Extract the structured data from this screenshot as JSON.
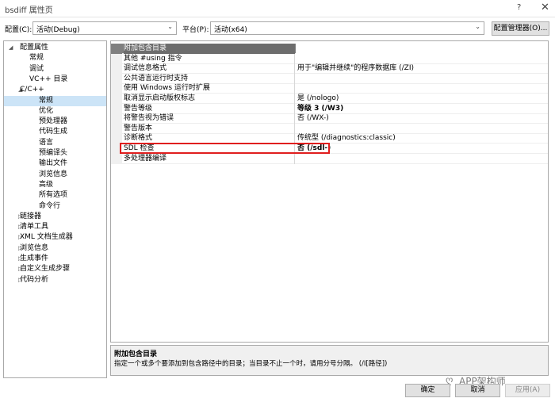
{
  "window": {
    "title": "bsdiff 属性页",
    "help": "?",
    "close": "✕"
  },
  "config": {
    "config_label": "配置(C):",
    "config_value": "活动(Debug)",
    "platform_label": "平台(P):",
    "platform_value": "活动(x64)",
    "manager_button": "配置管理器(O)..."
  },
  "tree": {
    "items": [
      {
        "label": "配置属性",
        "twisty": "◢"
      },
      {
        "label": "常规"
      },
      {
        "label": "调试"
      },
      {
        "label": "VC++ 目录"
      },
      {
        "label": "C/C++",
        "twisty": "◢"
      },
      {
        "label": "常规",
        "selected": true
      },
      {
        "label": "优化"
      },
      {
        "label": "预处理器"
      },
      {
        "label": "代码生成"
      },
      {
        "label": "语言"
      },
      {
        "label": "预编译头"
      },
      {
        "label": "输出文件"
      },
      {
        "label": "浏览信息"
      },
      {
        "label": "高级"
      },
      {
        "label": "所有选项"
      },
      {
        "label": "命令行"
      },
      {
        "label": "链接器",
        "twisty": "▷"
      },
      {
        "label": "清单工具",
        "twisty": "▷"
      },
      {
        "label": "XML 文档生成器",
        "twisty": "▷"
      },
      {
        "label": "浏览信息",
        "twisty": "▷"
      },
      {
        "label": "生成事件",
        "twisty": "▷"
      },
      {
        "label": "自定义生成步骤",
        "twisty": "▷"
      },
      {
        "label": "代码分析",
        "twisty": "▷"
      }
    ]
  },
  "properties": [
    {
      "name": "附加包含目录",
      "value": ""
    },
    {
      "name": "其他 #using 指令",
      "value": ""
    },
    {
      "name": "调试信息格式",
      "value": "用于\"编辑并继续\"的程序数据库 (/ZI)"
    },
    {
      "name": "公共语言运行时支持",
      "value": ""
    },
    {
      "name": "使用 Windows 运行时扩展",
      "value": ""
    },
    {
      "name": "取消显示启动版权标志",
      "value": "是 (/nologo)"
    },
    {
      "name": "警告等级",
      "value": "等级 3 (/W3)",
      "bold": true
    },
    {
      "name": "将警告视为错误",
      "value": "否 (/WX-)"
    },
    {
      "name": "警告版本",
      "value": ""
    },
    {
      "name": "诊断格式",
      "value": "传统型 (/diagnostics:classic)"
    },
    {
      "name": "SDL 检查",
      "value": "否 (/sdl-)",
      "bold": true
    },
    {
      "name": "多处理器编译",
      "value": ""
    }
  ],
  "description": {
    "title": "附加包含目录",
    "text": "指定一个或多个要添加到包含路径中的目录；当目录不止一个时，请用分号分隔。     (/I[路径])"
  },
  "watermark": {
    "text": "APP架构师"
  },
  "buttons": {
    "ok": "确定",
    "cancel": "取消",
    "apply": "应用(A)"
  }
}
